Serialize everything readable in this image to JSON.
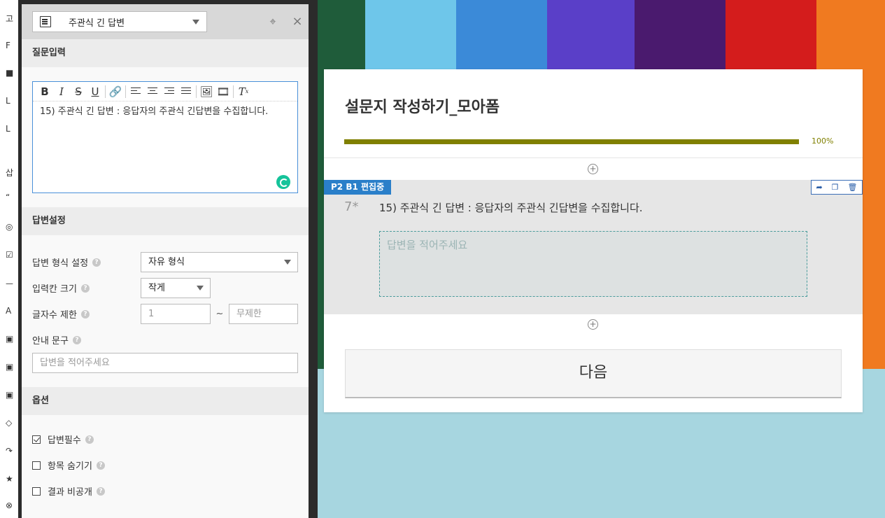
{
  "sidebar_sliver": {
    "glyphs": [
      "고",
      "F",
      "■",
      "L",
      "L",
      "삽",
      "“",
      "◎",
      "☑",
      "ㅡ",
      "A",
      "▣",
      "▣",
      "▣",
      "◇",
      "↷",
      "★",
      "⊗"
    ]
  },
  "panel": {
    "type_select": {
      "icon": "document-lines-icon",
      "label": "주관식 긴 답변"
    },
    "header_icons": {
      "target": "crosshair-icon",
      "close": "close-icon"
    },
    "question_section": {
      "title": "질문입력",
      "editor_toolbar": [
        "B",
        "I",
        "S",
        "U",
        "link",
        "align-left",
        "align-center",
        "align-right",
        "align-justify",
        "image",
        "video",
        "clear-format"
      ],
      "editor_text": "15) 주관식 긴 답변 : 응답자의 주관식 긴답변을 수집합니다."
    },
    "answer_section": {
      "title": "답변설정",
      "format_label": "답변 형식 설정",
      "format_value": "자유 형식",
      "size_label": "입력칸 크기",
      "size_value": "작게",
      "length_label": "글자수 제한",
      "length_min": "1",
      "length_separator": "~",
      "length_max_placeholder": "무제한",
      "guide_label": "안내 문구",
      "guide_placeholder": "답변을 적어주세요"
    },
    "options_section": {
      "title": "옵션",
      "options": [
        {
          "label": "답변필수",
          "checked": true
        },
        {
          "label": "항목 숨기기",
          "checked": false
        },
        {
          "label": "결과 비공개",
          "checked": false
        }
      ]
    }
  },
  "survey": {
    "title": "설문지 작성하기_모아폼",
    "progress_value": 100,
    "progress_text": "100%",
    "block_tag": "P2 B1 편집중",
    "question_number": "7*",
    "question_text": "15) 주관식 긴 답변 : 응답자의 주관식 긴답변을 수집합니다.",
    "answer_placeholder": "답변을 적어주세요",
    "next_label": "다음",
    "colors": {
      "progress": "#808000",
      "tag": "#2a7fc9"
    }
  },
  "background": {
    "stripe_colors": [
      "#1f5c3a",
      "#6ec6ea",
      "#3b7fd4",
      "#5a3fc8",
      "#4a1a6e",
      "#d41c1c",
      "#f07a20"
    ],
    "bottom_color": "#a7d6e0"
  }
}
